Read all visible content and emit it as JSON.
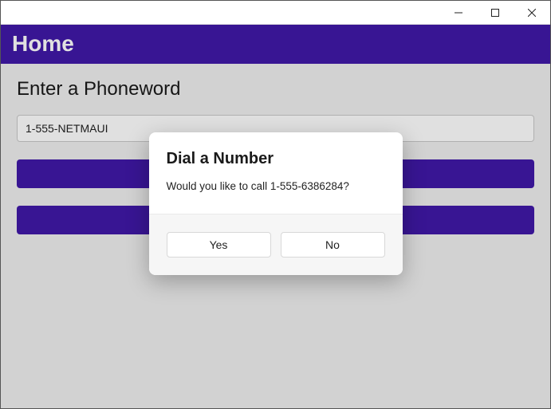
{
  "window": {
    "title": ""
  },
  "header": {
    "title": "Home"
  },
  "main": {
    "prompt_label": "Enter a Phoneword",
    "phoneword_value": "1-555-NETMAUI",
    "translate_label": "",
    "call_label": ""
  },
  "dialog": {
    "title": "Dial a Number",
    "message": "Would you like to call 1-555-6386284?",
    "yes_label": "Yes",
    "no_label": "No"
  },
  "colors": {
    "accent": "#4019a8"
  }
}
